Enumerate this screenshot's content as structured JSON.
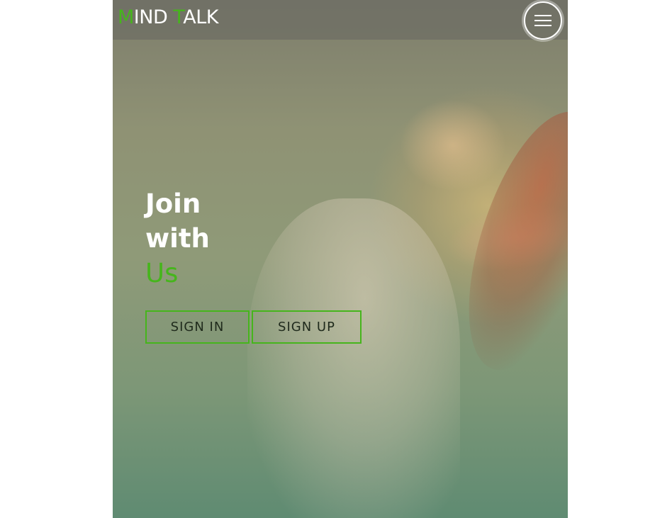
{
  "header": {
    "logo": {
      "first_initial": "M",
      "first_rest": "IND ",
      "second_initial": "T",
      "second_rest": "ALK"
    },
    "menu_icon": "hamburger-menu-icon"
  },
  "hero": {
    "headline_line1": "Join",
    "headline_line2": "with",
    "headline_accent": "Us",
    "sign_in_label": "SIGN IN",
    "sign_up_label": "SIGN UP"
  },
  "colors": {
    "accent": "#46b51c",
    "header_bg": "#6e6e64",
    "text_light": "#ffffff"
  }
}
